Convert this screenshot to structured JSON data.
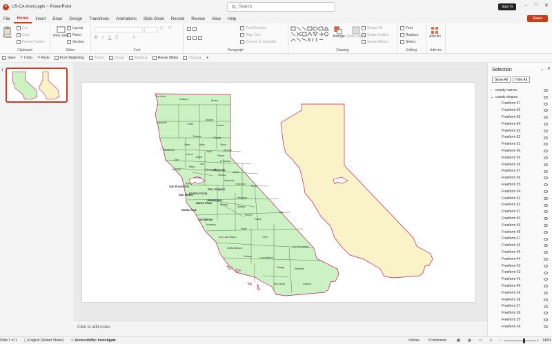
{
  "window": {
    "app_title": "US-CA-mono.pptx  ~  PowerPoint",
    "app_logo": "P"
  },
  "search": {
    "placeholder": "Search"
  },
  "account": {
    "sign_in": "Sign in",
    "share": "Share"
  },
  "tabs": [
    "File",
    "Home",
    "Insert",
    "Draw",
    "Design",
    "Transitions",
    "Animations",
    "Slide Show",
    "Record",
    "Review",
    "View",
    "Help"
  ],
  "active_tab": "Home",
  "ribbon": {
    "clipboard": {
      "paste": "Paste",
      "cut": "Cut",
      "copy": "Copy",
      "format_painter": "Format Painter",
      "label": "Clipboard"
    },
    "slides": {
      "new_slide": "New Slide",
      "layout": "Layout",
      "reset": "Reset",
      "section": "Section",
      "label": "Slides"
    },
    "font": {
      "label": "Font"
    },
    "paragraph": {
      "text_direction": "Text Direction",
      "align_text": "Align Text",
      "convert_smartart": "Convert to SmartArt",
      "label": "Paragraph"
    },
    "drawing": {
      "arrange": "Arrange",
      "quick_styles": "Quick Styles",
      "shape_fill": "Shape Fill",
      "shape_outline": "Shape Outline",
      "shape_effects": "Shape Effects",
      "label": "Drawing"
    },
    "editing": {
      "find": "Find",
      "replace": "Replace",
      "select": "Select",
      "label": "Editing"
    },
    "addins": {
      "addins": "Add-ins",
      "label": "Add-ins"
    }
  },
  "qat": {
    "save": "Save",
    "undo": "Undo",
    "redo": "Redo",
    "from_beginning": "From Beginning",
    "action": "Action",
    "group": "Group",
    "regroup": "Regroup",
    "reuse_slides": "Reuse Slides",
    "ungroup": "Ungroup"
  },
  "thumbnails": {
    "slide_number": "1"
  },
  "slide": {
    "county_labels": [
      {
        "name": "Del Norte",
        "cls": ""
      },
      {
        "name": "Siskiyou",
        "cls": ""
      },
      {
        "name": "Modoc",
        "cls": ""
      },
      {
        "name": "Humboldt",
        "cls": ""
      },
      {
        "name": "Trinity",
        "cls": ""
      },
      {
        "name": "Shasta",
        "cls": ""
      },
      {
        "name": "Lassen",
        "cls": ""
      },
      {
        "name": "Tehama",
        "cls": ""
      },
      {
        "name": "Plumas",
        "cls": ""
      },
      {
        "name": "Mendocino",
        "cls": ""
      },
      {
        "name": "Glenn",
        "cls": ""
      },
      {
        "name": "Butte",
        "cls": ""
      },
      {
        "name": "Sierra",
        "cls": ""
      },
      {
        "name": "Nevada",
        "cls": ""
      },
      {
        "name": "Lake",
        "cls": ""
      },
      {
        "name": "Colusa",
        "cls": ""
      },
      {
        "name": "Sutter",
        "cls": ""
      },
      {
        "name": "Yuba",
        "cls": ""
      },
      {
        "name": "Placer",
        "cls": ""
      },
      {
        "name": "El Dorado",
        "cls": ""
      },
      {
        "name": "Sonoma",
        "cls": ""
      },
      {
        "name": "Napa",
        "cls": ""
      },
      {
        "name": "Yolo",
        "cls": ""
      },
      {
        "name": "Sacramento",
        "cls": ""
      },
      {
        "name": "Alpine",
        "cls": ""
      },
      {
        "name": "Amador",
        "cls": ""
      },
      {
        "name": "Marin",
        "cls": ""
      },
      {
        "name": "Solano",
        "cls": ""
      },
      {
        "name": "Contra Costa",
        "cls": "big"
      },
      {
        "name": "San Joaquin",
        "cls": "big"
      },
      {
        "name": "Calaveras",
        "cls": ""
      },
      {
        "name": "Tuolumne",
        "cls": ""
      },
      {
        "name": "Mono",
        "cls": ""
      },
      {
        "name": "Alameda",
        "cls": "big"
      },
      {
        "name": "Stanislaus",
        "cls": "big"
      },
      {
        "name": "Mariposa",
        "cls": ""
      },
      {
        "name": "San Francisco",
        "cls": "big"
      },
      {
        "name": "San Mateo",
        "cls": "big"
      },
      {
        "name": "Santa Clara",
        "cls": "big"
      },
      {
        "name": "Merced",
        "cls": ""
      },
      {
        "name": "Madera",
        "cls": ""
      },
      {
        "name": "Santa Cruz",
        "cls": "big"
      },
      {
        "name": "Fresno",
        "cls": ""
      },
      {
        "name": "Inyo",
        "cls": ""
      },
      {
        "name": "San Benito",
        "cls": "big"
      },
      {
        "name": "Monterey",
        "cls": ""
      },
      {
        "name": "Tulare",
        "cls": ""
      },
      {
        "name": "Kings",
        "cls": ""
      },
      {
        "name": "San Luis Obispo",
        "cls": ""
      },
      {
        "name": "Kern",
        "cls": ""
      },
      {
        "name": "Santa Barbara",
        "cls": ""
      },
      {
        "name": "San Bernardino",
        "cls": ""
      },
      {
        "name": "Ventura",
        "cls": ""
      },
      {
        "name": "Los Angeles",
        "cls": ""
      },
      {
        "name": "Riverside",
        "cls": ""
      },
      {
        "name": "Orange",
        "cls": ""
      },
      {
        "name": "San Diego",
        "cls": ""
      },
      {
        "name": "Imperial",
        "cls": ""
      }
    ],
    "notes_placeholder": "Click to add notes"
  },
  "selection_pane": {
    "title": "Selection",
    "show_all": "Show All",
    "hide_all": "Hide All",
    "groups": [
      "county names",
      "county shapes"
    ],
    "items": [
      "Freeform 67",
      "Freeform 66",
      "Freeform 65",
      "Freeform 64",
      "Freeform 63",
      "Freeform 62",
      "Freeform 61",
      "Freeform 60",
      "Freeform 59",
      "Freeform 58",
      "Freeform 57",
      "Freeform 56",
      "Freeform 55",
      "Freeform 54",
      "Freeform 53",
      "Freeform 52",
      "Freeform 51",
      "Freeform 50",
      "Freeform 49",
      "Freeform 48",
      "Freeform 47",
      "Freeform 46",
      "Freeform 45",
      "Freeform 44",
      "Freeform 43",
      "Freeform 42",
      "Freeform 41",
      "Freeform 40",
      "Freeform 39",
      "Freeform 38",
      "Freeform 37",
      "Freeform 36",
      "Freeform 35",
      "Freeform 34"
    ]
  },
  "status": {
    "slide_info": "Slide 1 of 1",
    "language": "English (United States)",
    "accessibility": "Accessibility: Investigate",
    "notes": "Notes",
    "comments": "Comments",
    "zoom": "140%"
  },
  "colors": {
    "accent": "#c43e1c",
    "county_fill": "#ccf2c4",
    "mono_fill": "#fbf3c8",
    "outline": "#c2185b"
  }
}
